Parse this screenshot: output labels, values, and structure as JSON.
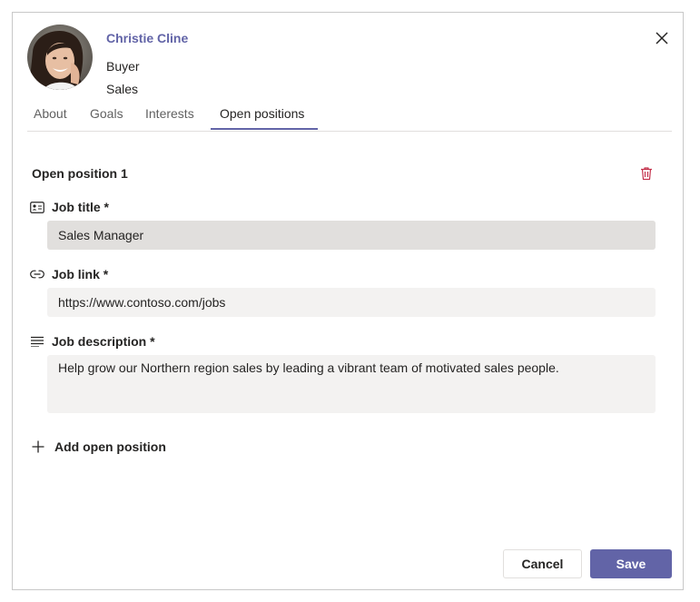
{
  "profile": {
    "name": "Christie Cline",
    "role": "Buyer",
    "department": "Sales"
  },
  "tabs": [
    {
      "label": "About",
      "active": false
    },
    {
      "label": "Goals",
      "active": false
    },
    {
      "label": "Interests",
      "active": false
    },
    {
      "label": "Open positions",
      "active": true
    }
  ],
  "position": {
    "title": "Open position 1",
    "job_title_label": "Job title *",
    "job_title_value": "Sales Manager",
    "job_link_label": "Job link *",
    "job_link_value": "https://www.contoso.com/jobs",
    "job_description_label": "Job description *",
    "job_description_value": "Help grow our Northern region sales by leading a vibrant team of motivated sales people."
  },
  "add_position_label": "Add open position",
  "buttons": {
    "cancel": "Cancel",
    "save": "Save"
  },
  "icons": {
    "close": "close-icon",
    "delete": "trash-icon",
    "job_title": "contact-card-icon",
    "job_link": "link-icon",
    "job_description": "text-lines-icon",
    "add": "plus-icon"
  },
  "colors": {
    "accent": "#6264a7",
    "danger": "#c4314b",
    "input_bg": "#f3f2f1",
    "input_focused_bg": "#e1dfdd"
  }
}
